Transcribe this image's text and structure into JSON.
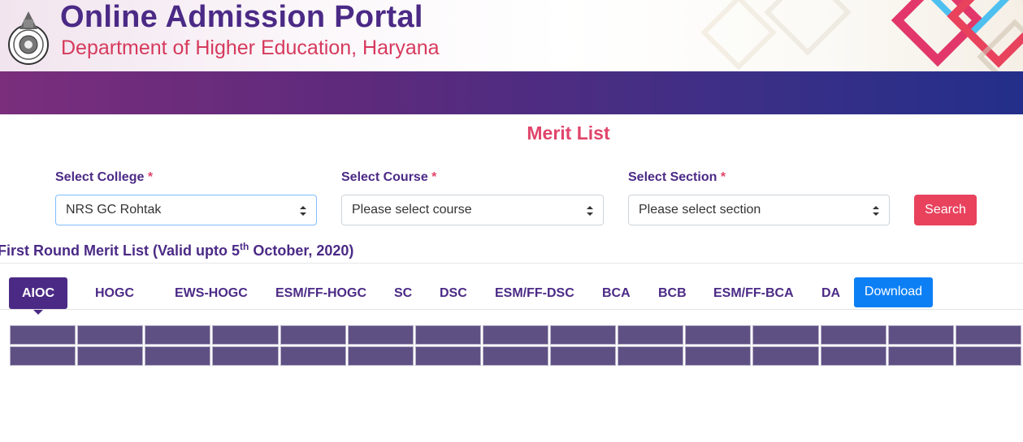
{
  "header": {
    "title": "Online Admission Portal",
    "subtitle": "Department of Higher Education, Haryana"
  },
  "page": {
    "heading": "Merit List"
  },
  "form": {
    "college": {
      "label": "Select College",
      "required": "*",
      "value": "NRS GC Rohtak"
    },
    "course": {
      "label": "Select Course",
      "required": "*",
      "placeholder": "Please select course"
    },
    "section": {
      "label": "Select Section",
      "required": "*",
      "placeholder": "Please select section"
    },
    "search_label": "Search"
  },
  "round": {
    "prefix": "First Round Merit List (Valid upto 5",
    "sup": "th",
    "suffix": " October, 2020)"
  },
  "tabs": [
    {
      "label": "AIOC",
      "active": true
    },
    {
      "label": "HOGC"
    },
    {
      "label": "EWS-HOGC"
    },
    {
      "label": "ESM/FF-HOGC"
    },
    {
      "label": "SC"
    },
    {
      "label": "DSC"
    },
    {
      "label": "ESM/FF-DSC"
    },
    {
      "label": "BCA"
    },
    {
      "label": "BCB"
    },
    {
      "label": "ESM/FF-BCA"
    },
    {
      "label": "DA"
    }
  ],
  "download_label": "Download",
  "colors": {
    "primary": "#4b2a86",
    "accent": "#e0456b",
    "download": "#0d7ff5",
    "table_cell": "#5f5084"
  },
  "icons": [
    "state-emblem-icon",
    "select-arrows-icon"
  ]
}
